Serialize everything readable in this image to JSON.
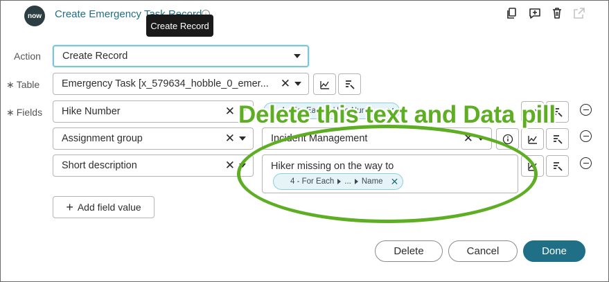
{
  "header": {
    "logo_text": "now",
    "title": "Create Emergency Task Record",
    "tooltip": "Create Record",
    "icons": [
      "copy-icon",
      "comment-add-icon",
      "trash-icon",
      "open-external-icon"
    ]
  },
  "form": {
    "action": {
      "label": "Action",
      "value": "Create Record"
    },
    "table": {
      "label": "Table",
      "required_mark": "∗",
      "value": "Emergency Task [x_579634_hobble_0_emer..."
    },
    "fields": {
      "label": "Fields",
      "required_mark": "∗",
      "rows": [
        {
          "name": "Hike Number",
          "pill": {
            "parts": [
              "4 - For Ea...",
              "Hike Numb..."
            ]
          }
        },
        {
          "name": "Assignment group",
          "value": "Incident Management"
        },
        {
          "name": "Short description",
          "value": "Hiker missing on the way to",
          "pill": {
            "parts": [
              "4 - For Each",
              "...",
              "Name"
            ]
          }
        }
      ]
    },
    "clear_glyph": "✕",
    "add_field_value": "Add field value"
  },
  "footer": {
    "delete": "Delete",
    "cancel": "Cancel",
    "done": "Done"
  },
  "annotation": {
    "text": "Delete this text and Data pill",
    "color": "#5eae24"
  },
  "colors": {
    "brand": "#1f6f86",
    "pill_bg": "#e6f4f7",
    "tooltip_bg": "#1a1a1a"
  }
}
